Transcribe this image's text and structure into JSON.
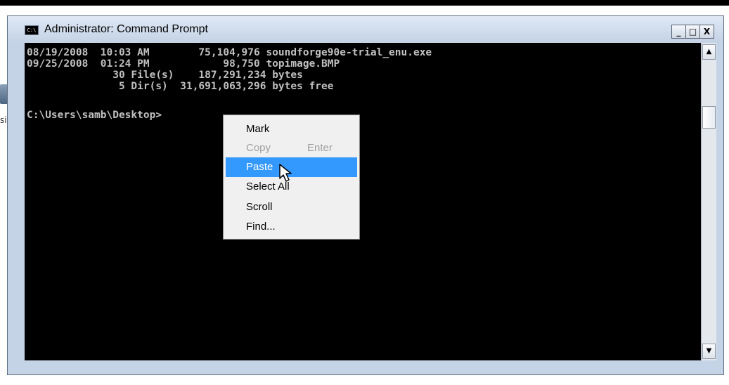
{
  "window": {
    "title": "Administrator: Command Prompt",
    "icon_label": "C:\\",
    "controls": {
      "minimize": "_",
      "maximize": "□",
      "close": "X"
    }
  },
  "console": {
    "lines": [
      "08/19/2008  10:03 AM        75,104,976 soundforge90e-trial_enu.exe",
      "09/25/2008  01:24 PM            98,750 topimage.BMP",
      "              30 File(s)    187,291,234 bytes",
      "               5 Dir(s)  31,691,063,296 bytes free",
      "",
      "C:\\Users\\samb\\Desktop>"
    ]
  },
  "desktop": {
    "icon_label": "sis"
  },
  "context_menu": {
    "items": [
      {
        "label": "Mark",
        "shortcut": "",
        "enabled": true
      },
      {
        "label": "Copy",
        "shortcut": "Enter",
        "enabled": false
      },
      {
        "label": "Paste",
        "shortcut": "",
        "enabled": true,
        "highlighted": true
      },
      {
        "label": "Select All",
        "shortcut": "",
        "enabled": true
      },
      {
        "label": "Scroll",
        "shortcut": "",
        "enabled": true
      },
      {
        "label": "Find...",
        "shortcut": "",
        "enabled": true
      }
    ]
  },
  "scrollbar": {
    "up_arrow": "▲",
    "down_arrow": "▼"
  },
  "colors": {
    "console_bg": "#000000",
    "console_text": "#c0c0c0",
    "menu_highlight": "#3399ff",
    "menu_disabled": "#a0a0a0",
    "titlebar": "#c5d3e6"
  }
}
